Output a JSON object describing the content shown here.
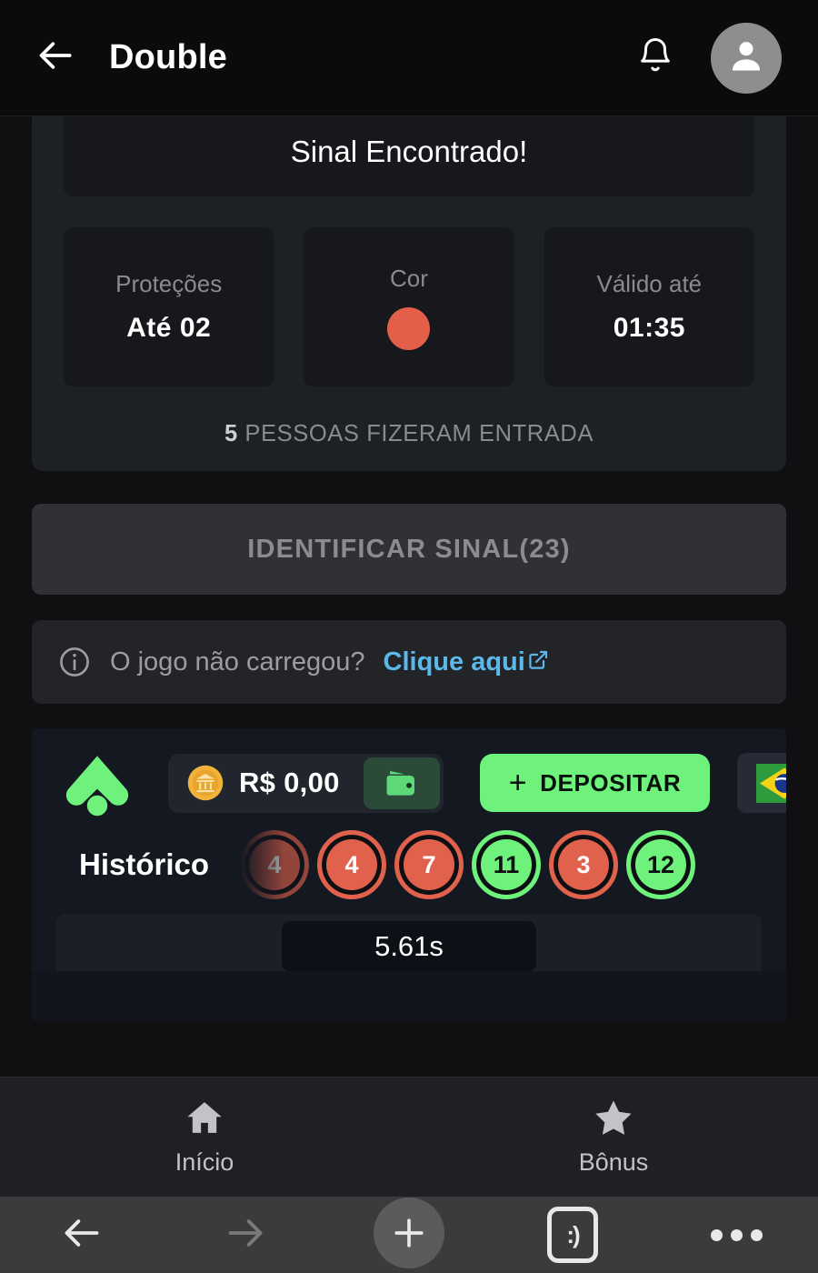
{
  "header": {
    "back_icon": "arrow-left-icon",
    "title": "Double",
    "bell_icon": "bell-icon",
    "avatar_icon": "person-icon"
  },
  "signal": {
    "banner_text": "Sinal Encontrado!",
    "stats": [
      {
        "label": "Proteções",
        "value": "Até 02",
        "type": "text"
      },
      {
        "label": "Cor",
        "value": "",
        "type": "color",
        "color": "#e35f4a"
      },
      {
        "label": "Válido até",
        "value": "01:35",
        "type": "text"
      }
    ],
    "entries_count": "5",
    "entries_text": " PESSOAS FIZERAM ENTRADA",
    "identify_button": "IDENTIFICAR SINAL(23)"
  },
  "info_bar": {
    "icon": "info-circle-icon",
    "message": "O jogo não carregou?",
    "link_label": "Clique aqui",
    "link_icon": "external-link-icon"
  },
  "game": {
    "logo_icon": "blaze-arrow-logo",
    "balance": {
      "coin_icon": "bank-coin-icon",
      "amount": "R$ 0,00",
      "wallet_icon": "wallet-icon"
    },
    "deposit_button": {
      "plus": "+",
      "label": "DEPOSITAR"
    },
    "flag_button": {
      "icon": "brazil-flag-icon"
    },
    "history_label": "Histórico",
    "history": [
      {
        "value": "4",
        "color": "red",
        "faded": true
      },
      {
        "value": "4",
        "color": "red",
        "faded": false
      },
      {
        "value": "7",
        "color": "red",
        "faded": false
      },
      {
        "value": "11",
        "color": "green",
        "faded": false
      },
      {
        "value": "3",
        "color": "red",
        "faded": false
      },
      {
        "value": "12",
        "color": "green",
        "faded": false
      }
    ],
    "timer": "5.61s",
    "colors": {
      "red": "#e0614c",
      "green": "#6ef27b",
      "accent": "#6ef27b"
    }
  },
  "tabbar": {
    "items": [
      {
        "icon": "home-icon",
        "label": "Início"
      },
      {
        "icon": "star-icon",
        "label": "Bônus"
      }
    ]
  },
  "browser": {
    "items": [
      {
        "icon": "arrow-left-icon",
        "label": ""
      },
      {
        "icon": "arrow-right-icon",
        "label": ""
      },
      {
        "icon": "plus-icon",
        "label": ""
      },
      {
        "icon": "tabs-icon",
        "label": ":)"
      },
      {
        "icon": "more-dots-icon",
        "label": ""
      }
    ]
  }
}
